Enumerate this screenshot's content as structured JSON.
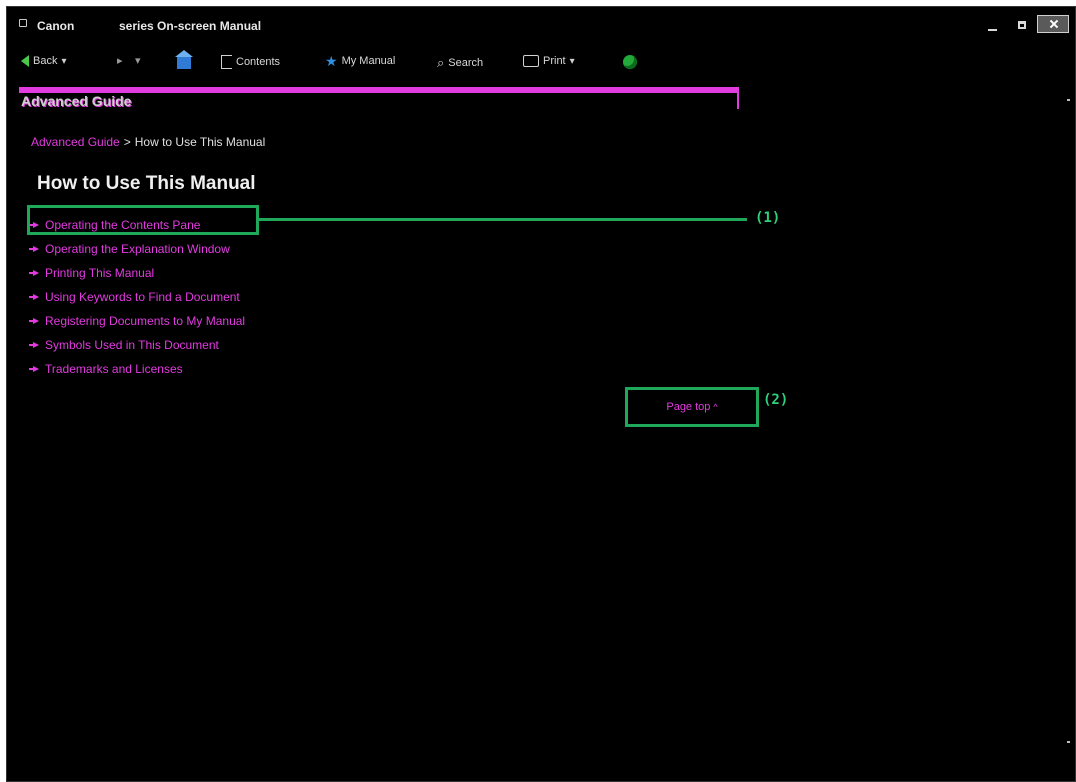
{
  "window": {
    "brand": "Canon",
    "title": "series On-screen Manual"
  },
  "toolbar": {
    "back_label": "Back",
    "contents_label": "Contents",
    "mymanual_label": "My Manual",
    "search_label": "Search",
    "print_label": "Print"
  },
  "header": {
    "title": "Advanced Guide"
  },
  "breadcrumb": {
    "link": "Advanced Guide",
    "separator": ">",
    "current": "How to Use This Manual"
  },
  "main": {
    "title": "How to Use This Manual",
    "topics": [
      "Operating the Contents Pane",
      "Operating the Explanation Window",
      "Printing This Manual",
      "Using Keywords to Find a Document",
      "Registering Documents to My Manual",
      "Symbols Used in This Document",
      "Trademarks and Licenses"
    ],
    "page_top_label": "Page top"
  },
  "callouts": {
    "label_1": "(1)",
    "label_2": "(2)"
  },
  "colors": {
    "accent": "#e23be0",
    "callout": "#1fa85a",
    "background": "#000000"
  },
  "icons": {
    "back": "back-arrow-icon",
    "home": "home-icon",
    "contents": "contents-icon",
    "mymanual": "star-icon",
    "search": "search-icon",
    "print": "print-icon",
    "web": "globe-icon",
    "bullet": "arrow-bullet-icon",
    "page_top": "up-arrow-icon"
  }
}
